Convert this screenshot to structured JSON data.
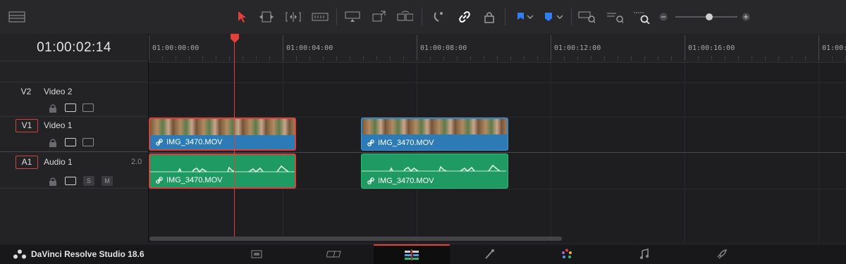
{
  "app": {
    "name": "DaVinci Resolve Studio 18.6"
  },
  "toolbar": {
    "icons": [
      "layout-toggle-icon",
      "selection-pointer-icon",
      "trim-edit-icon",
      "dynamic-trim-icon",
      "blade-icon",
      "insert-clip-icon",
      "overwrite-clip-icon",
      "replace-clip-icon",
      "snapping-icon",
      "linked-selection-icon",
      "position-lock-icon",
      "flag-icon",
      "marker-icon",
      "zoom-full-icon",
      "zoom-detail-icon",
      "zoom-custom-icon",
      "zoom-out-icon",
      "zoom-in-icon"
    ],
    "zoom_level": 0.55,
    "accent_color": "#e0413a",
    "flag_color": "#2f7ef6"
  },
  "timecode": "01:00:02:14",
  "ruler": {
    "labels": [
      "01:00:00:00",
      "01:00:04:00",
      "01:00:08:00",
      "01:00:12:00",
      "01:00:16:00",
      "01:00:2"
    ]
  },
  "tracks": {
    "v2": {
      "id": "V2",
      "name": "Video 2"
    },
    "v1": {
      "id": "V1",
      "name": "Video 1"
    },
    "a1": {
      "id": "A1",
      "name": "Audio 1",
      "channels": "2.0",
      "solo": "S",
      "mute": "M"
    }
  },
  "clips": {
    "v1_clip1": {
      "name": "IMG_3470.MOV",
      "selected": true
    },
    "v1_clip2": {
      "name": "IMG_3470.MOV",
      "selected": false
    },
    "a1_clip1": {
      "name": "IMG_3470.MOV",
      "selected": true
    },
    "a1_clip2": {
      "name": "IMG_3470.MOV",
      "selected": false
    }
  },
  "colors": {
    "video_clip": "#2c7bb6",
    "audio_clip": "#1f9a63",
    "playhead": "#e0413a"
  },
  "pages": [
    "media-page-icon",
    "cut-page-icon",
    "edit-page-icon",
    "fusion-page-icon",
    "color-page-icon",
    "fairlight-page-icon",
    "deliver-page-icon"
  ],
  "active_page": "edit-page-icon"
}
